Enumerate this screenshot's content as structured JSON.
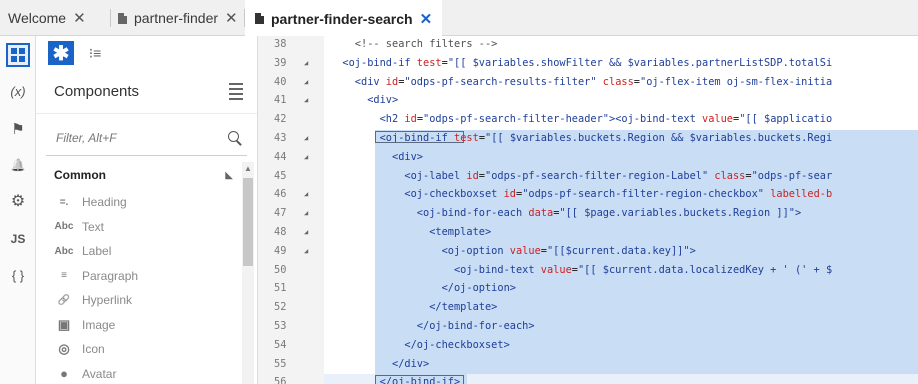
{
  "tabs": [
    {
      "label": "Welcome",
      "close": "✕",
      "active": false,
      "has_icon": false
    },
    {
      "label": "partner-finder",
      "close": "✕",
      "active": false,
      "has_icon": true
    },
    {
      "label": "partner-finder-search",
      "close": "✕",
      "active": true,
      "has_icon": true
    }
  ],
  "rail": {
    "items": [
      {
        "name": "components-rail-icon",
        "glyph": "",
        "active": true
      },
      {
        "name": "variables-rail-icon",
        "glyph": "(x)",
        "active": false
      },
      {
        "name": "actions-rail-icon",
        "glyph": "⚑",
        "active": false
      },
      {
        "name": "events-rail-icon",
        "glyph": "🔔",
        "active": false
      },
      {
        "name": "settings-rail-icon",
        "glyph": "⚙",
        "active": false
      },
      {
        "name": "javascript-rail-icon",
        "glyph": "JS",
        "active": false
      },
      {
        "name": "json-rail-icon",
        "glyph": "{ }",
        "active": false
      }
    ]
  },
  "panel": {
    "title": "Components",
    "filter_placeholder": "Filter, Alt+F",
    "category": "Common",
    "items": [
      {
        "label": "Heading",
        "icon": "heading-icon",
        "glyph": "=."
      },
      {
        "label": "Text",
        "icon": "text-icon",
        "glyph": "Abc"
      },
      {
        "label": "Label",
        "icon": "label-icon",
        "glyph": "Abc"
      },
      {
        "label": "Paragraph",
        "icon": "paragraph-icon",
        "glyph": "≡"
      },
      {
        "label": "Hyperlink",
        "icon": "hyperlink-icon",
        "glyph": "🔗"
      },
      {
        "label": "Image",
        "icon": "image-icon",
        "glyph": "▣"
      },
      {
        "label": "Icon",
        "icon": "icon-icon",
        "glyph": "◎"
      },
      {
        "label": "Avatar",
        "icon": "avatar-icon",
        "glyph": "●"
      }
    ]
  },
  "editor": {
    "lines": [
      {
        "n": "38",
        "fold": false,
        "sel": false,
        "parts": [
          [
            "t-cmt",
            "    <!-- search filters -->"
          ]
        ]
      },
      {
        "n": "39",
        "fold": true,
        "sel": false,
        "parts": [
          [
            "t-tag",
            "  <oj-bind-if "
          ],
          [
            "t-attr",
            "test"
          ],
          [
            "t-txt",
            "="
          ],
          [
            "t-str",
            "\"[[ $variables.showFilter && $variables.partnerListSDP.totalSi"
          ]
        ]
      },
      {
        "n": "40",
        "fold": true,
        "sel": false,
        "parts": [
          [
            "t-tag",
            "    <div "
          ],
          [
            "t-attr",
            "id"
          ],
          [
            "t-txt",
            "="
          ],
          [
            "t-str",
            "\"odps-pf-search-results-filter\" "
          ],
          [
            "t-attr",
            "class"
          ],
          [
            "t-txt",
            "="
          ],
          [
            "t-str",
            "\"oj-flex-item oj-sm-flex-initia"
          ]
        ]
      },
      {
        "n": "41",
        "fold": true,
        "sel": false,
        "parts": [
          [
            "t-tag",
            "      <div>"
          ]
        ]
      },
      {
        "n": "42",
        "fold": false,
        "sel": false,
        "parts": [
          [
            "t-tag",
            "        <h2 "
          ],
          [
            "t-attr",
            "id"
          ],
          [
            "t-txt",
            "="
          ],
          [
            "t-str",
            "\"odps-pf-search-filter-header\""
          ],
          [
            "t-tag",
            "><oj-bind-text "
          ],
          [
            "t-attr",
            "value"
          ],
          [
            "t-txt",
            "="
          ],
          [
            "t-str",
            "\"[[ $applicatio"
          ]
        ]
      },
      {
        "n": "43",
        "fold": true,
        "sel": true,
        "parts": [
          [
            "t-tag",
            "        <oj-bind-if "
          ],
          [
            "t-attr",
            "test"
          ],
          [
            "t-txt",
            "="
          ],
          [
            "t-str",
            "\"[[ $variables.buckets.Region && $variables.buckets.Regi"
          ]
        ]
      },
      {
        "n": "44",
        "fold": true,
        "sel": true,
        "parts": [
          [
            "t-tag",
            "          <div>"
          ]
        ]
      },
      {
        "n": "45",
        "fold": false,
        "sel": true,
        "parts": [
          [
            "t-tag",
            "            <oj-label "
          ],
          [
            "t-attr",
            "id"
          ],
          [
            "t-txt",
            "="
          ],
          [
            "t-str",
            "\"odps-pf-search-filter-region-Label\" "
          ],
          [
            "t-attr",
            "class"
          ],
          [
            "t-txt",
            "="
          ],
          [
            "t-str",
            "\"odps-pf-sear"
          ]
        ]
      },
      {
        "n": "46",
        "fold": true,
        "sel": true,
        "parts": [
          [
            "t-tag",
            "            <oj-checkboxset "
          ],
          [
            "t-attr",
            "id"
          ],
          [
            "t-txt",
            "="
          ],
          [
            "t-str",
            "\"odps-pf-search-filter-region-checkbox\" "
          ],
          [
            "t-attr",
            "labelled-b"
          ]
        ]
      },
      {
        "n": "47",
        "fold": true,
        "sel": true,
        "parts": [
          [
            "t-tag",
            "              <oj-bind-for-each "
          ],
          [
            "t-attr",
            "data"
          ],
          [
            "t-txt",
            "="
          ],
          [
            "t-str",
            "\"[[ $page.variables.buckets.Region ]]\""
          ],
          [
            "t-tag",
            ">"
          ]
        ]
      },
      {
        "n": "48",
        "fold": true,
        "sel": true,
        "parts": [
          [
            "t-tag",
            "                <template>"
          ]
        ]
      },
      {
        "n": "49",
        "fold": true,
        "sel": true,
        "parts": [
          [
            "t-tag",
            "                  <oj-option "
          ],
          [
            "t-attr",
            "value"
          ],
          [
            "t-txt",
            "="
          ],
          [
            "t-str",
            "\"[[$current.data.key]]\""
          ],
          [
            "t-tag",
            ">"
          ]
        ]
      },
      {
        "n": "50",
        "fold": false,
        "sel": true,
        "parts": [
          [
            "t-tag",
            "                    <oj-bind-text "
          ],
          [
            "t-attr",
            "value"
          ],
          [
            "t-txt",
            "="
          ],
          [
            "t-str",
            "\"[[ $current.data.localizedKey + ' (' + $"
          ]
        ]
      },
      {
        "n": "51",
        "fold": false,
        "sel": true,
        "parts": [
          [
            "t-tag",
            "                  </oj-option>"
          ]
        ]
      },
      {
        "n": "52",
        "fold": false,
        "sel": true,
        "parts": [
          [
            "t-tag",
            "                </template>"
          ]
        ]
      },
      {
        "n": "53",
        "fold": false,
        "sel": true,
        "parts": [
          [
            "t-tag",
            "              </oj-bind-for-each>"
          ]
        ]
      },
      {
        "n": "54",
        "fold": false,
        "sel": true,
        "parts": [
          [
            "t-tag",
            "            </oj-checkboxset>"
          ]
        ]
      },
      {
        "n": "55",
        "fold": false,
        "sel": true,
        "parts": [
          [
            "t-tag",
            "          </div>"
          ]
        ]
      },
      {
        "n": "56",
        "fold": false,
        "sel": false,
        "parts": [
          [
            "t-tag",
            "        </oj-bind-if>"
          ]
        ]
      }
    ]
  }
}
